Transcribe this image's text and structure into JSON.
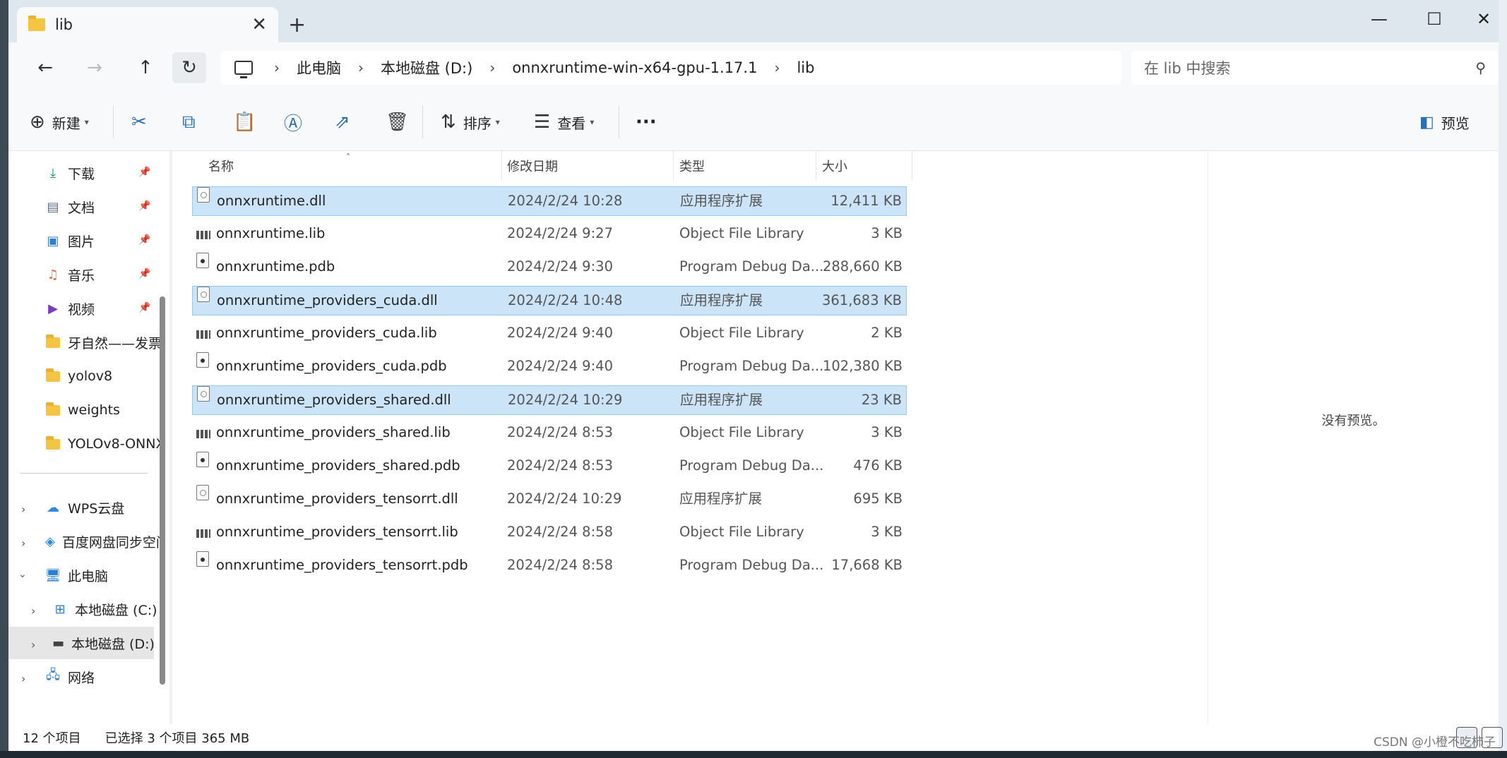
{
  "window": {
    "tab_title": "lib",
    "tab_close": "✕",
    "new_tab": "+",
    "minimize": "—",
    "maximize": "☐",
    "close": "✕"
  },
  "nav": {
    "back": "←",
    "forward": "→",
    "up": "↑",
    "refresh": "↻",
    "breadcrumbs": [
      "此电脑",
      "本地磁盘 (D:)",
      "onnxruntime-win-x64-gpu-1.17.1",
      "lib"
    ],
    "search_placeholder": "在 lib 中搜索"
  },
  "toolbar": {
    "new_label": "新建",
    "sort_label": "排序",
    "view_label": "查看",
    "more": "···",
    "preview_label": "预览"
  },
  "sidebar": {
    "quick_access": [
      {
        "label": "下载",
        "icon": "download-icon"
      },
      {
        "label": "文档",
        "icon": "document-icon"
      },
      {
        "label": "图片",
        "icon": "picture-icon"
      },
      {
        "label": "音乐",
        "icon": "music-icon"
      },
      {
        "label": "视频",
        "icon": "video-icon"
      },
      {
        "label": "牙自然——发票",
        "icon": "folder-icon"
      },
      {
        "label": "yolov8",
        "icon": "folder-icon"
      },
      {
        "label": "weights",
        "icon": "folder-icon"
      },
      {
        "label": "YOLOv8-ONNX",
        "icon": "folder-icon"
      }
    ],
    "locations": [
      {
        "label": "WPS云盘"
      },
      {
        "label": "百度网盘同步空间"
      },
      {
        "label": "此电脑"
      },
      {
        "label": "本地磁盘 (C:)"
      },
      {
        "label": "本地磁盘 (D:)"
      },
      {
        "label": "网络"
      }
    ]
  },
  "columns": {
    "name": "名称",
    "date": "修改日期",
    "type": "类型",
    "size": "大小"
  },
  "files": [
    {
      "name": "onnxruntime.dll",
      "date": "2024/2/24 10:28",
      "type": "应用程序扩展",
      "size": "12,411 KB",
      "kind": "dll",
      "selected": true
    },
    {
      "name": "onnxruntime.lib",
      "date": "2024/2/24 9:27",
      "type": "Object File Library",
      "size": "3 KB",
      "kind": "lib",
      "selected": false
    },
    {
      "name": "onnxruntime.pdb",
      "date": "2024/2/24 9:30",
      "type": "Program Debug Da...",
      "size": "288,660 KB",
      "kind": "pdb",
      "selected": false
    },
    {
      "name": "onnxruntime_providers_cuda.dll",
      "date": "2024/2/24 10:48",
      "type": "应用程序扩展",
      "size": "361,683 KB",
      "kind": "dll",
      "selected": true
    },
    {
      "name": "onnxruntime_providers_cuda.lib",
      "date": "2024/2/24 9:40",
      "type": "Object File Library",
      "size": "2 KB",
      "kind": "lib",
      "selected": false
    },
    {
      "name": "onnxruntime_providers_cuda.pdb",
      "date": "2024/2/24 9:40",
      "type": "Program Debug Da...",
      "size": "102,380 KB",
      "kind": "pdb",
      "selected": false
    },
    {
      "name": "onnxruntime_providers_shared.dll",
      "date": "2024/2/24 10:29",
      "type": "应用程序扩展",
      "size": "23 KB",
      "kind": "dll",
      "selected": true
    },
    {
      "name": "onnxruntime_providers_shared.lib",
      "date": "2024/2/24 8:53",
      "type": "Object File Library",
      "size": "3 KB",
      "kind": "lib",
      "selected": false
    },
    {
      "name": "onnxruntime_providers_shared.pdb",
      "date": "2024/2/24 8:53",
      "type": "Program Debug Da...",
      "size": "476 KB",
      "kind": "pdb",
      "selected": false
    },
    {
      "name": "onnxruntime_providers_tensorrt.dll",
      "date": "2024/2/24 10:29",
      "type": "应用程序扩展",
      "size": "695 KB",
      "kind": "dll",
      "selected": false
    },
    {
      "name": "onnxruntime_providers_tensorrt.lib",
      "date": "2024/2/24 8:58",
      "type": "Object File Library",
      "size": "3 KB",
      "kind": "lib",
      "selected": false
    },
    {
      "name": "onnxruntime_providers_tensorrt.pdb",
      "date": "2024/2/24 8:58",
      "type": "Program Debug Da...",
      "size": "17,668 KB",
      "kind": "pdb",
      "selected": false
    }
  ],
  "preview": {
    "empty_text": "没有预览。"
  },
  "status": {
    "item_count": "12 个项目",
    "selection": "已选择 3 个项目  365 MB"
  },
  "watermark": "CSDN @小橙不吃柿子"
}
